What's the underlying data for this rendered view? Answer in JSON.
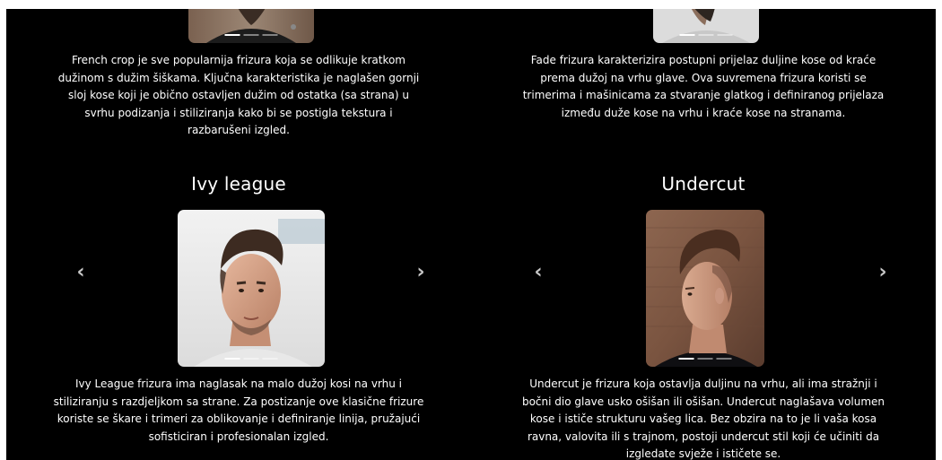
{
  "cards": {
    "french_crop": {
      "description_lines": [
        "French crop je sve popularnija frizura koja se odlikuje kratkom",
        "dužinom s dužim šiškama. Ključna karakteristika je naglašen gornji",
        "sloj kose koji je obično ostavljen dužim od ostatka (sa strana) u",
        "svrhu podizanja i stiliziranja kako bi se postigla tekstura i",
        "razbarušeni izgled."
      ]
    },
    "fade": {
      "description_lines": [
        "Fade frizura karakterizira postupni prijelaz duljine kose od kraće",
        "prema dužoj na vrhu glave. Ova suvremena frizura koristi se",
        "trimerima i mašinicama za stvaranje glatkog i definiranog prijelaza",
        "između duže kose na vrhu i kraće kose na stranama."
      ]
    },
    "ivy_league": {
      "title": "Ivy league",
      "description_lines": [
        "Ivy League frizura ima naglasak na malo dužoj kosi na vrhu i",
        "stiliziranju s razdjeljkom sa strane. Za postizanje ove klasične frizure",
        "koriste se škare i trimeri za oblikovanje i definiranje linija, pružajući",
        "sofisticiran i profesionalan izgled."
      ]
    },
    "undercut": {
      "title": "Undercut",
      "description_lines": [
        "Undercut je frizura koja ostavlja duljinu na vrhu, ali ima stražnji i",
        "bočni dio glave usko ošišan ili ošišan. Undercut naglašava volumen",
        "kose i ističe strukturu vašeg lica. Bez obzira na to je li vaša kosa",
        "ravna, valovita ili s trajnom, postoji undercut stil koji će učiniti da",
        "izgledate svježe i ističete se."
      ]
    }
  },
  "carousel": {
    "prev_glyph": "‹",
    "next_glyph": "›"
  },
  "colors": {
    "background": "#000000",
    "text": "#ffffff",
    "arrow": "#c8c8c8"
  }
}
